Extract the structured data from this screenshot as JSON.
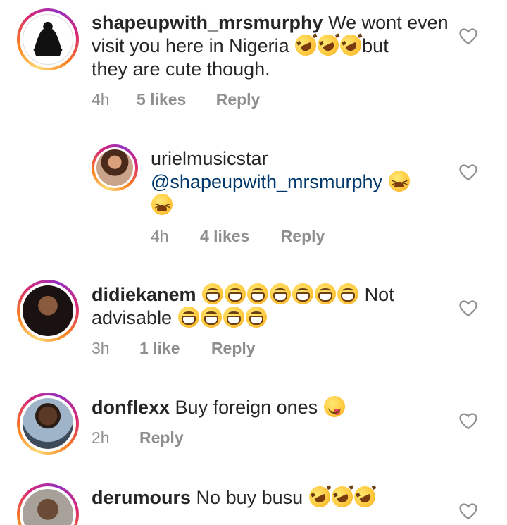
{
  "comments": [
    {
      "username": "shapeupwith_mrsmurphy",
      "text_line1": "We wont even",
      "text_line2": "visit you here in Nigeria",
      "text_line2_after": "but",
      "text_line3": "they are cute though.",
      "time": "4h",
      "likes": "5 likes",
      "reply": "Reply",
      "emojis": [
        "rolling-on-floor-laughing",
        "rolling-on-floor-laughing",
        "rolling-on-floor-laughing"
      ]
    },
    {
      "username": "urielmusicstar",
      "mention": "@shapeupwith_mrsmurphy",
      "time": "4h",
      "likes": "4 likes",
      "reply": "Reply",
      "emojis": [
        "squinting-laughing",
        "squinting-laughing"
      ]
    },
    {
      "username": "didiekanem",
      "text_after_emojis": "Not",
      "text_line2": "advisable",
      "time": "3h",
      "likes": "1 like",
      "reply": "Reply",
      "emojis": [
        "grinning-face",
        "grinning-face",
        "grinning-face",
        "grinning-face",
        "grinning-face",
        "grinning-face",
        "grinning-face",
        "grinning-face",
        "grinning-face",
        "grinning-face",
        "grinning-face"
      ]
    },
    {
      "username": "donflexx",
      "text": "Buy foreign ones",
      "time": "2h",
      "reply": "Reply",
      "emojis": [
        "face-savoring-food"
      ]
    },
    {
      "username": "derumours",
      "text": "No buy busu",
      "emojis": [
        "rolling-on-floor-laughing",
        "rolling-on-floor-laughing",
        "rolling-on-floor-laughing"
      ]
    }
  ],
  "colors": {
    "text": "#262626",
    "meta": "#8e8e8e",
    "mention": "#00376b",
    "ring": "#d62976"
  },
  "icons": {
    "like": "heart-outline-icon"
  }
}
